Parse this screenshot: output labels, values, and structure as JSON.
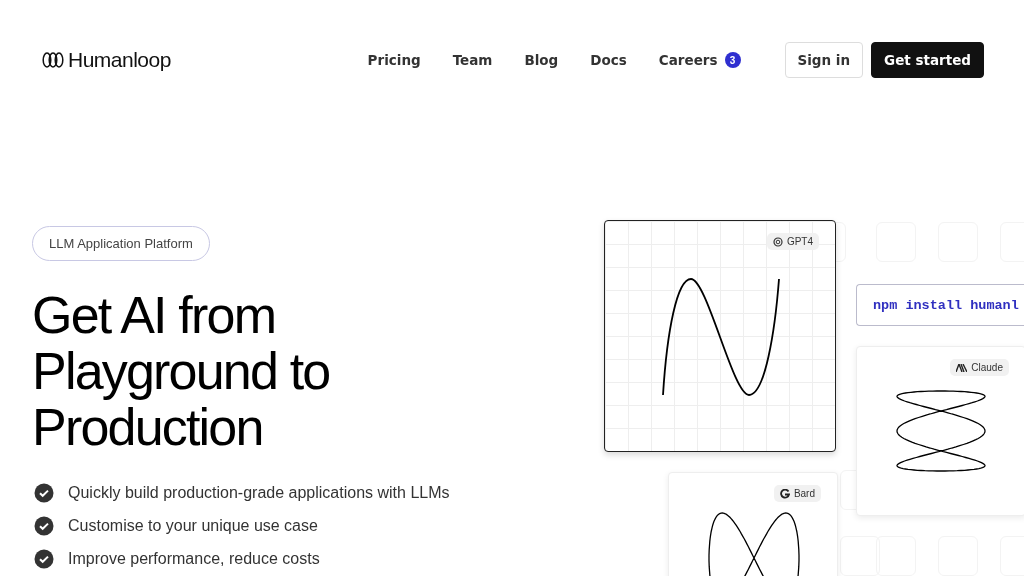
{
  "header": {
    "logo": "Humanloop",
    "nav": [
      {
        "label": "Pricing"
      },
      {
        "label": "Team"
      },
      {
        "label": "Blog"
      },
      {
        "label": "Docs"
      },
      {
        "label": "Careers",
        "badge": "3"
      }
    ],
    "sign_in": "Sign in",
    "get_started": "Get started"
  },
  "hero": {
    "tag": "LLM Application Platform",
    "title": "Get AI from Playground to Production",
    "features": [
      "Quickly build production-grade applications with LLMs",
      "Customise to your unique use case",
      "Improve performance, reduce costs"
    ]
  },
  "visual": {
    "cards": [
      {
        "kind": "gpt",
        "label": "GPT4"
      },
      {
        "kind": "claude",
        "label": "Claude"
      },
      {
        "kind": "bard",
        "label": "Bard"
      }
    ],
    "command": "npm install humanl"
  }
}
